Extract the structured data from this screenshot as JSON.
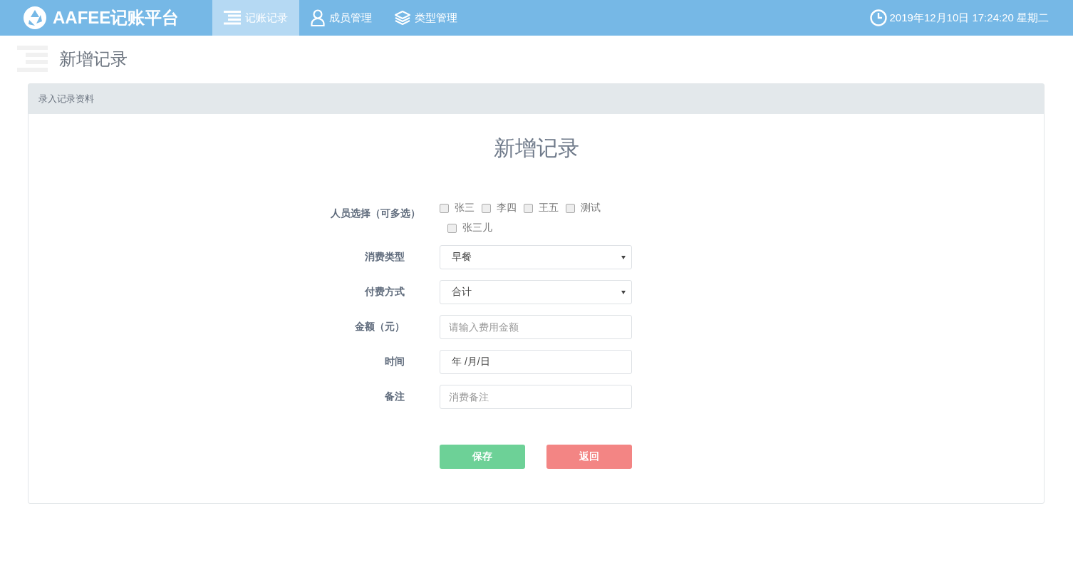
{
  "navbar": {
    "brand": "AAFEE记账平台",
    "tabs": [
      {
        "label": "记账记录",
        "selected": true
      },
      {
        "label": "成员管理",
        "selected": false
      },
      {
        "label": "类型管理",
        "selected": false
      }
    ],
    "clock": "2019年12月10日 17:24:20 星期二"
  },
  "page_title": "新增记录",
  "panel": {
    "header": "录入记录资料",
    "title": "新增记录",
    "fields": [
      {
        "kind": "checkboxes",
        "label": "人员选择（可多选）",
        "options": [
          {
            "label": "张三",
            "checked": false
          },
          {
            "label": "李四",
            "checked": false
          },
          {
            "label": "王五",
            "checked": false
          },
          {
            "label": "测试",
            "checked": false
          },
          {
            "label": "张三儿",
            "checked": false
          }
        ]
      },
      {
        "kind": "select",
        "label": "消费类型",
        "value": "早餐"
      },
      {
        "kind": "select",
        "label": "付费方式",
        "value": "合计"
      },
      {
        "kind": "input",
        "label": "金额（元）",
        "placeholder": "请输入费用金额"
      },
      {
        "kind": "date",
        "label": "时间",
        "value": "年 /月/日"
      },
      {
        "kind": "input",
        "label": "备注",
        "placeholder": "消费备注"
      }
    ],
    "buttons": [
      {
        "label": "保存",
        "kind": "primary"
      },
      {
        "label": "返回",
        "kind": "danger"
      }
    ]
  }
}
